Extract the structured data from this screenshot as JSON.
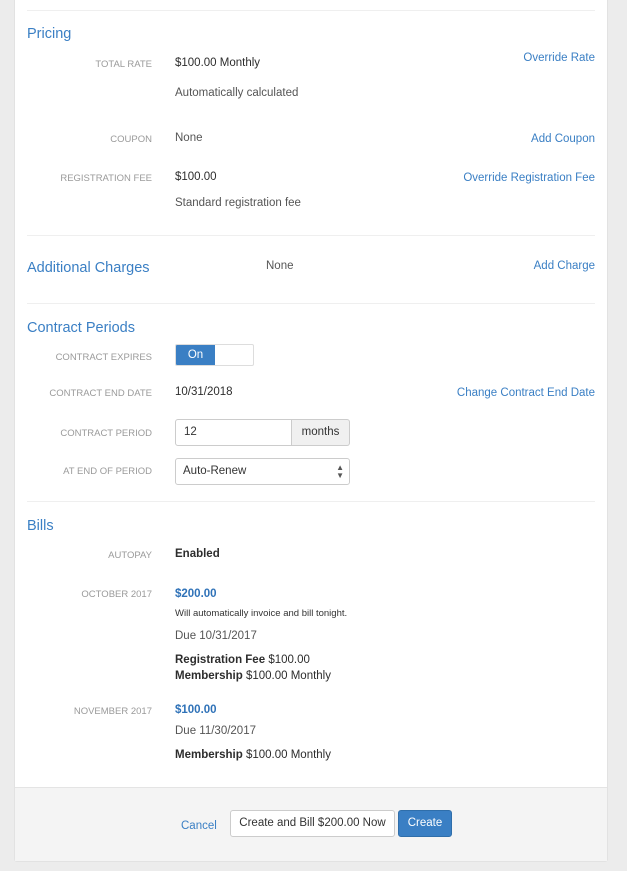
{
  "pricing": {
    "title": "Pricing",
    "total_rate": {
      "label": "Total Rate",
      "value": "$100.00 Monthly",
      "note": "Automatically calculated",
      "action": "Override Rate"
    },
    "coupon": {
      "label": "Coupon",
      "value": "None",
      "action": "Add Coupon"
    },
    "registration_fee": {
      "label": "Registration Fee",
      "value": "$100.00",
      "note": "Standard registration fee",
      "action": "Override Registration Fee"
    }
  },
  "additional_charges": {
    "title": "Additional Charges",
    "value": "None",
    "action": "Add Charge"
  },
  "contract_periods": {
    "title": "Contract Periods",
    "contract_expires": {
      "label": "Contract Expires",
      "toggle_label": "On",
      "state": true
    },
    "contract_end_date": {
      "label": "Contract End Date",
      "value": "10/31/2018",
      "action": "Change Contract End Date"
    },
    "contract_period": {
      "label": "Contract Period",
      "value": "12",
      "unit": "months"
    },
    "end_of_period": {
      "label": "At End of Period",
      "selected": "Auto-Renew"
    }
  },
  "bills": {
    "title": "Bills",
    "autopay": {
      "label": "Autopay",
      "value": "Enabled"
    },
    "items": [
      {
        "label": "October 2017",
        "amount": "$200.00",
        "note": "Will automatically invoice and bill tonight.",
        "due": "Due 10/31/2017",
        "lines": [
          {
            "name": "Registration Fee",
            "value": "$100.00"
          },
          {
            "name": "Membership",
            "value": "$100.00 Monthly"
          }
        ]
      },
      {
        "label": "November 2017",
        "amount": "$100.00",
        "due": "Due 11/30/2017",
        "lines": [
          {
            "name": "Membership",
            "value": "$100.00 Monthly"
          }
        ]
      }
    ]
  },
  "footer": {
    "cancel": "Cancel",
    "create_and_bill": "Create and Bill $200.00 Now",
    "create": "Create"
  }
}
